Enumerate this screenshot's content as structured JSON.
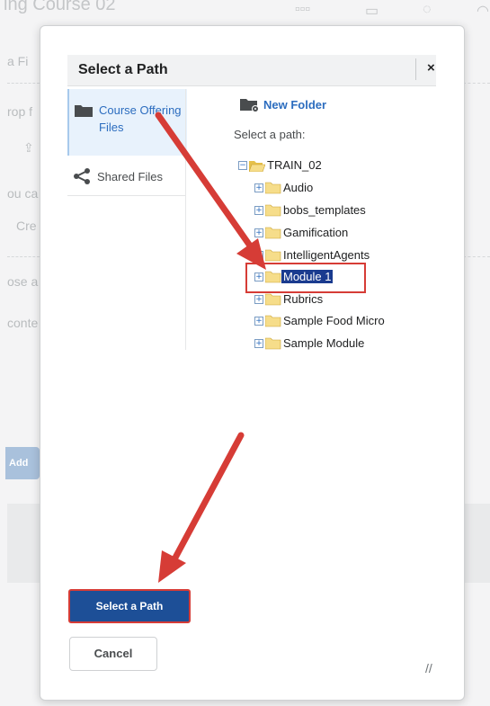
{
  "background": {
    "title_fragment": "ing Course 02",
    "left_fragments": [
      "a Fi",
      "rop f",
      "ou ca",
      "Cre",
      "ose a",
      "conte"
    ],
    "add_button": "Add"
  },
  "dialog": {
    "title": "Select a Path",
    "close_glyph": "×",
    "nav": [
      {
        "label": "Course Offering Files",
        "icon": "folder-icon",
        "active": true
      },
      {
        "label": "Shared Files",
        "icon": "share-icon",
        "active": false
      }
    ],
    "new_folder_label": "New Folder",
    "select_path_label": "Select a path:",
    "tree": {
      "root": {
        "label": "TRAIN_02",
        "expanded": true
      },
      "children": [
        {
          "label": "Audio",
          "selected": false
        },
        {
          "label": "bobs_templates",
          "selected": false
        },
        {
          "label": "Gamification",
          "selected": false
        },
        {
          "label": "IntelligentAgents",
          "selected": false
        },
        {
          "label": "Module 1",
          "selected": true
        },
        {
          "label": "Rubrics",
          "selected": false
        },
        {
          "label": "Sample Food Micro",
          "selected": false
        },
        {
          "label": "Sample Module",
          "selected": false
        }
      ]
    },
    "select_button": "Select a Path",
    "cancel_button": "Cancel"
  },
  "colors": {
    "accent_blue": "#2c6dbf",
    "primary_button": "#1d4f97",
    "selection": "#1a3b8f",
    "annotation_red": "#d63c36",
    "folder_fill": "#f6dd8a"
  }
}
